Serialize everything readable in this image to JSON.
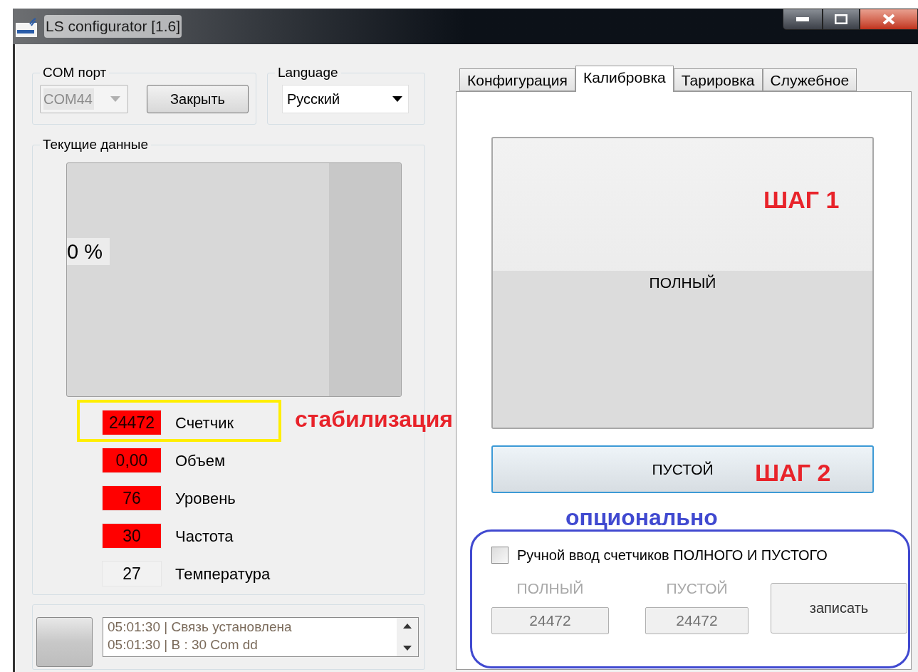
{
  "window": {
    "title": "LS configurator [1.6]"
  },
  "com_port": {
    "label": "COM порт",
    "value": "COM44",
    "disabled": true,
    "button": "Закрыть"
  },
  "language": {
    "label": "Language",
    "value": "Русский"
  },
  "current_data": {
    "label": "Текущие данные",
    "gauge": {
      "reading": "0 %"
    },
    "readings": [
      {
        "value": "24472",
        "label": "Счетчик",
        "alarm": true
      },
      {
        "value": "0,00",
        "label": "Объем",
        "alarm": true
      },
      {
        "value": "76",
        "label": "Уровень",
        "alarm": true
      },
      {
        "value": "30",
        "label": "Частота",
        "alarm": true
      },
      {
        "value": "27",
        "label": "Температура",
        "alarm": false
      }
    ]
  },
  "log": [
    "05:01:30 | Связь установлена",
    "05:01:30 |  B : 30 Com dd"
  ],
  "tabs": [
    {
      "label": "Конфигурация",
      "selected": false
    },
    {
      "label": "Калибровка",
      "selected": true
    },
    {
      "label": "Тарировка",
      "selected": false
    },
    {
      "label": "Служебное",
      "selected": false
    }
  ],
  "calibration": {
    "full_button": "ПОЛНЫЙ",
    "empty_button": "ПУСТОЙ",
    "manual": {
      "label": "Ручной ввод счетчиков ПОЛНОГО И ПУСТОГО",
      "checked": false,
      "full_label": "ПОЛНЫЙ",
      "full_value": "24472",
      "empty_label": "ПУСТОЙ",
      "empty_value": "24472",
      "write_button": "записать"
    }
  },
  "annotations": {
    "stabilization": "стабилизация",
    "step1": "ШАГ 1",
    "step2": "ШАГ 2",
    "optional": "опционально"
  }
}
